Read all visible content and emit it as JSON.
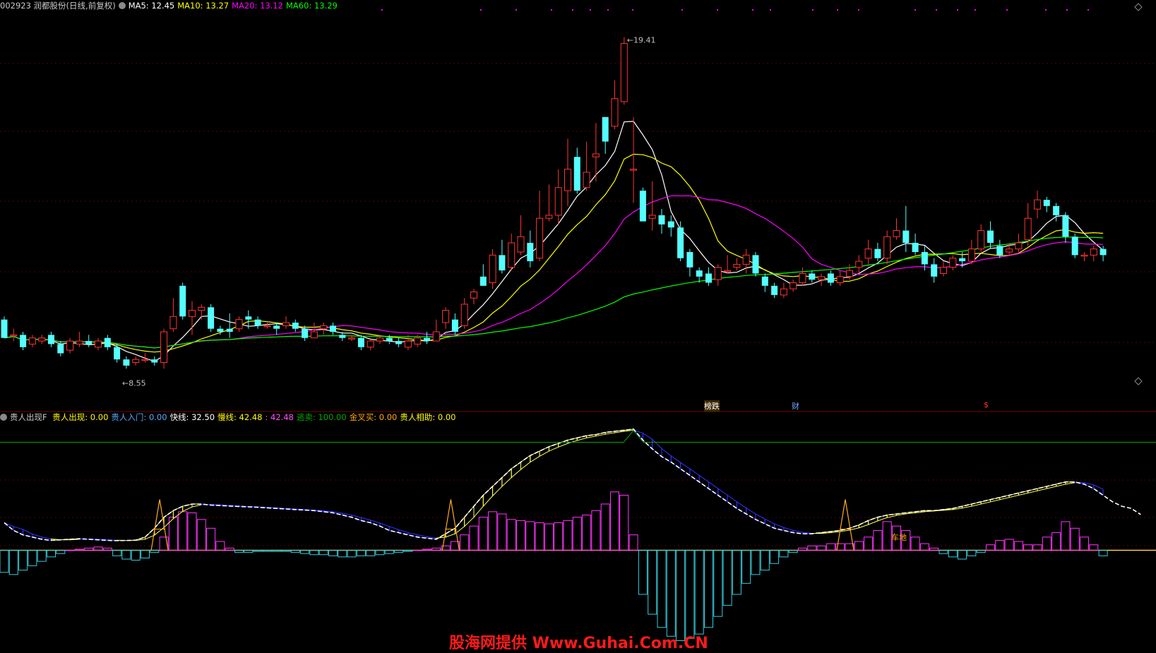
{
  "header_top": {
    "stock": "002923 润都股份(日线,前复权)",
    "ma5": "MA5: 12.45",
    "ma10": "MA10: 13.27",
    "ma20": "MA20: 13.12",
    "ma60": "MA60: 13.29"
  },
  "header_bottom": {
    "indicator": "贵人出现F",
    "items": [
      {
        "text": "贵人出现: 0.00",
        "color": "#ffff00"
      },
      {
        "text": "贵人入门: 0.00",
        "color": "#55aaff"
      },
      {
        "text": "快线: 32.50",
        "color": "#ffffff"
      },
      {
        "text": "慢线: 42.48",
        "color": "#ffff00"
      },
      {
        "text": ": 42.48",
        "color": "#ff55ff"
      },
      {
        "text": "逃卖: 100.00",
        "color": "#00aa00"
      },
      {
        "text": "金叉买: 0.00",
        "color": "#ffaa00"
      },
      {
        "text": "贵人相助: 0.00",
        "color": "#ffff00"
      }
    ]
  },
  "markers": {
    "high": "19.41",
    "low": "8.55",
    "event1": "榜跌",
    "event2": "财",
    "event3": "$",
    "sub_label": "车地"
  },
  "watermark": "股海网提供 Www.Guhai.Com.CN",
  "colors": {
    "up": "#ff3333",
    "down": "#54ffff",
    "ma5": "#ffffff",
    "ma10": "#ffff00",
    "ma20": "#ff00ff",
    "ma60": "#00ff00"
  },
  "chart_data": [
    {
      "type": "candlestick",
      "title": "002923 润都股份(日线,前复权)",
      "ylim": [
        7.5,
        20.2
      ],
      "candles": [
        [
          10.2,
          9.6,
          10.3,
          9.6
        ],
        [
          9.7,
          9.7,
          9.9,
          9.5
        ],
        [
          9.7,
          9.3,
          9.8,
          9.2
        ],
        [
          9.4,
          9.6,
          9.7,
          9.3
        ],
        [
          9.5,
          9.6,
          9.7,
          9.4
        ],
        [
          9.7,
          9.4,
          9.8,
          9.3
        ],
        [
          9.4,
          9.1,
          9.5,
          9.0
        ],
        [
          9.2,
          9.5,
          9.6,
          9.1
        ],
        [
          9.4,
          9.5,
          9.8,
          9.3
        ],
        [
          9.5,
          9.4,
          9.7,
          9.3
        ],
        [
          9.3,
          9.5,
          9.6,
          9.2
        ],
        [
          9.6,
          9.3,
          9.7,
          9.2
        ],
        [
          9.3,
          8.9,
          9.4,
          8.8
        ],
        [
          8.9,
          8.7,
          9.0,
          8.6
        ],
        [
          8.8,
          8.9,
          9.0,
          8.7
        ],
        [
          8.9,
          8.9,
          9.1,
          8.8
        ],
        [
          8.9,
          8.8,
          9.0,
          8.7
        ],
        [
          8.8,
          9.8,
          9.9,
          8.6
        ],
        [
          9.9,
          10.3,
          10.9,
          9.8
        ],
        [
          11.3,
          10.3,
          11.4,
          10.2
        ],
        [
          10.3,
          10.5,
          10.8,
          9.7
        ],
        [
          10.5,
          10.6,
          10.7,
          10.2
        ],
        [
          10.6,
          9.9,
          10.7,
          9.8
        ],
        [
          9.9,
          9.8,
          10.0,
          9.7
        ],
        [
          9.9,
          9.8,
          10.4,
          9.6
        ],
        [
          9.9,
          10.2,
          10.3,
          9.8
        ],
        [
          10.3,
          10.2,
          10.5,
          9.9
        ],
        [
          10.2,
          10.0,
          10.3,
          9.9
        ],
        [
          10.0,
          10.0,
          10.1,
          9.9
        ],
        [
          10.0,
          9.9,
          10.1,
          9.7
        ],
        [
          10.0,
          10.1,
          10.3,
          9.9
        ],
        [
          10.1,
          9.9,
          10.2,
          9.8
        ],
        [
          9.9,
          9.6,
          10.0,
          9.5
        ],
        [
          9.6,
          9.8,
          10.1,
          9.6
        ],
        [
          9.9,
          10.0,
          10.1,
          9.7
        ],
        [
          10.0,
          9.8,
          10.1,
          9.7
        ],
        [
          9.7,
          9.6,
          9.8,
          9.5
        ],
        [
          9.6,
          9.6,
          9.7,
          9.5
        ],
        [
          9.6,
          9.3,
          9.7,
          9.2
        ],
        [
          9.3,
          9.5,
          9.6,
          9.2
        ],
        [
          9.5,
          9.6,
          9.7,
          9.4
        ],
        [
          9.6,
          9.5,
          9.7,
          9.4
        ],
        [
          9.5,
          9.4,
          9.6,
          9.3
        ],
        [
          9.3,
          9.5,
          9.7,
          9.2
        ],
        [
          9.4,
          9.6,
          9.7,
          9.3
        ],
        [
          9.6,
          9.5,
          9.8,
          9.4
        ],
        [
          9.5,
          9.8,
          10.2,
          9.5
        ],
        [
          10.1,
          10.5,
          10.6,
          9.9
        ],
        [
          10.2,
          9.8,
          10.4,
          9.7
        ],
        [
          10.0,
          10.7,
          10.9,
          9.9
        ],
        [
          10.9,
          11.1,
          11.2,
          10.7
        ],
        [
          11.6,
          11.3,
          12.0,
          11.3
        ],
        [
          11.4,
          12.3,
          12.5,
          11.2
        ],
        [
          12.3,
          11.8,
          12.8,
          11.7
        ],
        [
          11.9,
          12.7,
          13.0,
          11.8
        ],
        [
          12.4,
          12.9,
          13.6,
          12.3
        ],
        [
          12.7,
          12.1,
          13.1,
          11.9
        ],
        [
          12.2,
          13.5,
          14.4,
          12.1
        ],
        [
          13.5,
          13.6,
          14.6,
          13.4
        ],
        [
          13.6,
          14.5,
          15.1,
          13.3
        ],
        [
          14.4,
          15.1,
          16.1,
          13.9
        ],
        [
          15.5,
          14.4,
          15.8,
          14.3
        ],
        [
          14.5,
          15.0,
          16.0,
          14.4
        ],
        [
          15.5,
          15.6,
          16.6,
          14.7
        ],
        [
          16.8,
          16.0,
          16.8,
          15.6
        ],
        [
          16.5,
          17.4,
          18.0,
          16.4
        ],
        [
          17.3,
          19.2,
          19.4,
          17.2
        ],
        [
          15.1,
          15.1,
          16.8,
          14.0
        ],
        [
          14.4,
          13.4,
          14.5,
          13.4
        ],
        [
          13.5,
          13.6,
          14.7,
          13.1
        ],
        [
          13.6,
          13.3,
          13.8,
          13.0
        ],
        [
          13.4,
          13.2,
          13.6,
          12.9
        ],
        [
          13.2,
          12.2,
          13.4,
          12.1
        ],
        [
          12.4,
          11.9,
          12.5,
          11.6
        ],
        [
          11.8,
          11.6,
          11.9,
          11.4
        ],
        [
          11.7,
          11.4,
          11.9,
          11.3
        ],
        [
          11.5,
          11.9,
          12.0,
          11.3
        ],
        [
          11.8,
          11.8,
          12.3,
          11.7
        ],
        [
          11.9,
          12.0,
          12.2,
          11.8
        ],
        [
          12.0,
          12.3,
          12.5,
          11.7
        ],
        [
          12.3,
          11.7,
          12.4,
          11.6
        ],
        [
          11.6,
          11.3,
          11.7,
          11.1
        ],
        [
          11.3,
          11.0,
          11.4,
          10.9
        ],
        [
          11.0,
          11.2,
          11.4,
          10.9
        ],
        [
          11.2,
          11.4,
          11.5,
          11.1
        ],
        [
          11.4,
          11.7,
          11.9,
          11.3
        ],
        [
          11.7,
          11.5,
          11.8,
          11.4
        ],
        [
          11.5,
          11.6,
          11.7,
          11.3
        ],
        [
          11.7,
          11.4,
          11.8,
          11.3
        ],
        [
          11.4,
          11.6,
          11.8,
          11.3
        ],
        [
          11.6,
          11.8,
          12.0,
          11.5
        ],
        [
          11.9,
          12.1,
          12.3,
          11.7
        ],
        [
          12.2,
          12.5,
          12.8,
          12.0
        ],
        [
          12.5,
          12.2,
          12.7,
          12.1
        ],
        [
          12.2,
          12.9,
          13.1,
          12.0
        ],
        [
          12.9,
          13.1,
          13.5,
          12.8
        ],
        [
          13.1,
          12.7,
          13.9,
          12.4
        ],
        [
          12.7,
          12.4,
          13.0,
          12.3
        ],
        [
          12.4,
          12.0,
          12.6,
          11.8
        ],
        [
          12.0,
          11.6,
          12.2,
          11.4
        ],
        [
          11.7,
          11.9,
          12.1,
          11.6
        ],
        [
          11.9,
          12.2,
          12.3,
          11.8
        ],
        [
          12.2,
          12.1,
          12.4,
          11.9
        ],
        [
          12.1,
          12.5,
          12.8,
          12.0
        ],
        [
          12.5,
          13.1,
          13.3,
          12.4
        ],
        [
          13.1,
          12.7,
          13.4,
          12.5
        ],
        [
          12.6,
          12.3,
          12.8,
          12.2
        ],
        [
          12.4,
          12.5,
          12.7,
          12.3
        ],
        [
          12.5,
          12.7,
          13.0,
          12.4
        ],
        [
          12.8,
          13.5,
          14.0,
          12.6
        ],
        [
          13.8,
          14.1,
          14.4,
          13.5
        ],
        [
          14.1,
          13.9,
          14.2,
          13.7
        ],
        [
          13.9,
          13.6,
          14.0,
          13.4
        ],
        [
          13.6,
          12.9,
          13.7,
          12.7
        ],
        [
          12.9,
          12.3,
          13.0,
          12.2
        ],
        [
          12.3,
          12.3,
          12.4,
          12.1
        ],
        [
          12.3,
          12.5,
          12.6,
          12.1
        ],
        [
          12.5,
          12.3,
          12.6,
          12.1
        ]
      ],
      "ma_lines": [
        "MA5",
        "MA10",
        "MA20",
        "MA60"
      ],
      "high_marker": 19.41,
      "low_marker": 8.55
    },
    {
      "type": "indicator",
      "title": "贵人出现F",
      "ylim": [
        -90,
        115
      ],
      "fast": [
        25,
        18,
        14,
        12,
        10,
        9,
        9.5,
        10,
        10.5,
        10,
        9.5,
        9,
        8.8,
        8.9,
        9.2,
        12,
        20,
        30,
        36,
        40,
        42,
        42,
        41,
        40.6,
        40.2,
        39.8,
        39.4,
        39,
        38.5,
        38,
        37.5,
        37,
        36.5,
        36,
        35,
        34,
        32,
        30,
        27,
        25,
        22,
        18,
        16,
        14,
        12,
        11,
        10,
        15,
        20,
        30,
        40,
        50,
        58,
        66,
        74,
        80,
        86,
        90,
        94,
        97,
        100,
        102,
        104,
        105,
        107,
        108,
        109,
        110,
        100,
        92,
        85,
        80,
        74,
        68,
        62,
        56,
        50,
        44,
        38,
        33,
        28,
        24,
        20,
        18,
        16,
        15,
        15,
        16,
        17,
        18,
        20,
        23,
        27,
        30,
        32,
        33,
        34,
        35,
        36,
        36,
        37,
        38,
        40,
        42,
        44,
        46,
        48,
        50,
        52,
        54,
        56,
        58,
        60,
        62,
        62,
        60,
        56,
        50,
        44,
        40,
        38,
        32.5
      ],
      "histogram": [
        -20,
        -22,
        -18,
        -14,
        -10,
        -6,
        -3,
        0,
        1,
        2,
        3,
        2,
        -5,
        -8,
        -9,
        -7,
        -2,
        12,
        30,
        35,
        34,
        28,
        20,
        8,
        2,
        -2,
        -2,
        -1,
        -1,
        -1,
        -1,
        -2,
        -3,
        -4,
        -4,
        -5,
        -6,
        -6,
        -5,
        -5,
        -4,
        -3,
        -2,
        -1,
        0,
        1,
        2,
        4,
        8,
        14,
        22,
        30,
        35,
        33,
        28,
        27,
        26,
        25,
        24,
        25,
        27,
        30,
        32,
        36,
        42,
        53,
        50,
        14,
        -40,
        -58,
        -70,
        -78,
        -82,
        -80,
        -76,
        -70,
        -60,
        -50,
        -40,
        -30,
        -22,
        -18,
        -12,
        -6,
        -2,
        2,
        4,
        4,
        6,
        6,
        6,
        8,
        12,
        18,
        26,
        22,
        18,
        12,
        6,
        2,
        -3,
        -6,
        -8,
        -5,
        -2,
        5,
        9,
        10,
        8,
        5,
        5,
        12,
        16,
        26,
        20,
        12,
        5,
        -5,
        -15,
        -22,
        -25,
        -22,
        -12
      ],
      "green_line": 98
    }
  ]
}
